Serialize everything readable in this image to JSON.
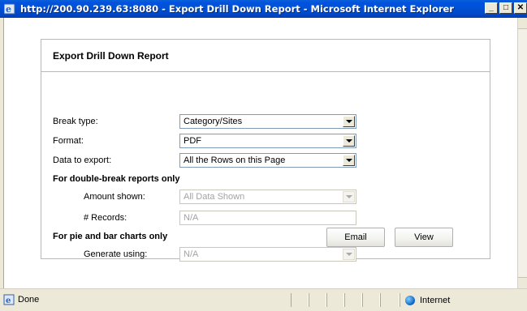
{
  "window": {
    "title": "http://200.90.239.63:8080 - Export Drill Down Report - Microsoft Internet Explorer",
    "minimize_label": "_",
    "restore_label": "□",
    "close_label": "✕"
  },
  "dialog": {
    "title": "Export Drill Down Report",
    "fields": {
      "break_type": {
        "label": "Break type:",
        "value": "Category/Sites"
      },
      "format": {
        "label": "Format:",
        "value": "PDF"
      },
      "data_to_export": {
        "label": "Data to export:",
        "value": "All the Rows on this Page"
      }
    },
    "double_break": {
      "heading": "For double-break reports only",
      "amount_shown": {
        "label": "Amount shown:",
        "value": "All Data Shown"
      },
      "records": {
        "label": "# Records:",
        "value": "N/A"
      }
    },
    "charts": {
      "heading": "For pie and bar charts only",
      "generate_using": {
        "label": "Generate using:",
        "value": "N/A"
      }
    },
    "buttons": {
      "email": "Email",
      "view": "View"
    }
  },
  "statusbar": {
    "status": "Done",
    "zone": "Internet"
  }
}
